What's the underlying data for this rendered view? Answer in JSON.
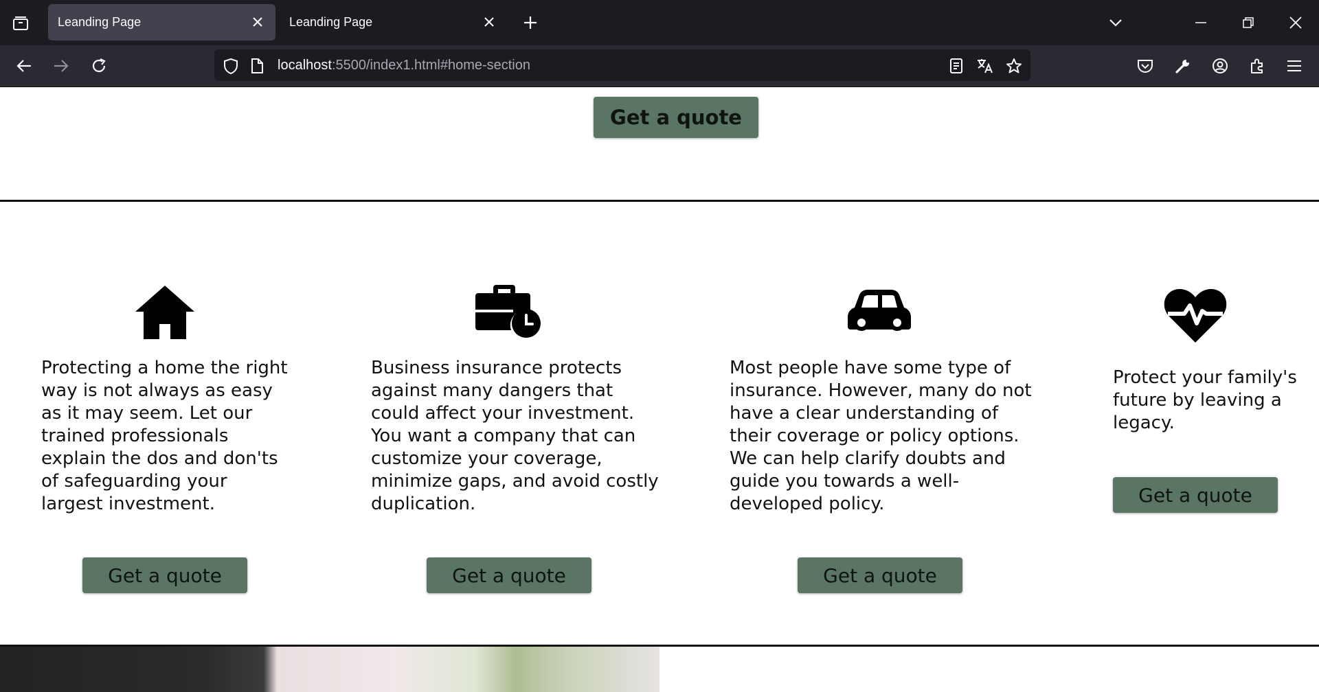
{
  "browser": {
    "tabs": [
      {
        "title": "Leanding Page",
        "active": true
      },
      {
        "title": "Leanding Page",
        "active": false
      }
    ],
    "url": {
      "host": "localhost",
      "rest": ":5500/index1.html#home-section"
    }
  },
  "page": {
    "top_button": "Get a quote",
    "services": [
      {
        "icon": "house-icon",
        "text": "Protecting a home the right way is not always as easy as it may seem. Let our trained professionals explain the dos and don'ts of safeguarding your largest investment.",
        "button": "Get a quote"
      },
      {
        "icon": "briefcase-clock-icon",
        "text": "Business insurance protects against many dangers that could affect your investment. You want a company that can customize your coverage, minimize gaps, and avoid costly duplication.",
        "button": "Get a quote"
      },
      {
        "icon": "car-icon",
        "text": "Most people have some type of insurance. However, many do not have a clear understanding of their coverage or policy options. We can help clarify doubts and guide you towards a well-developed policy.",
        "button": "Get a quote"
      },
      {
        "icon": "heart-pulse-icon",
        "text": "Protect your family's future by leaving a legacy.",
        "button": "Get a quote"
      }
    ]
  },
  "colors": {
    "button": "#5a7564",
    "chrome_dark": "#1c1b22",
    "chrome": "#2b2a33"
  }
}
